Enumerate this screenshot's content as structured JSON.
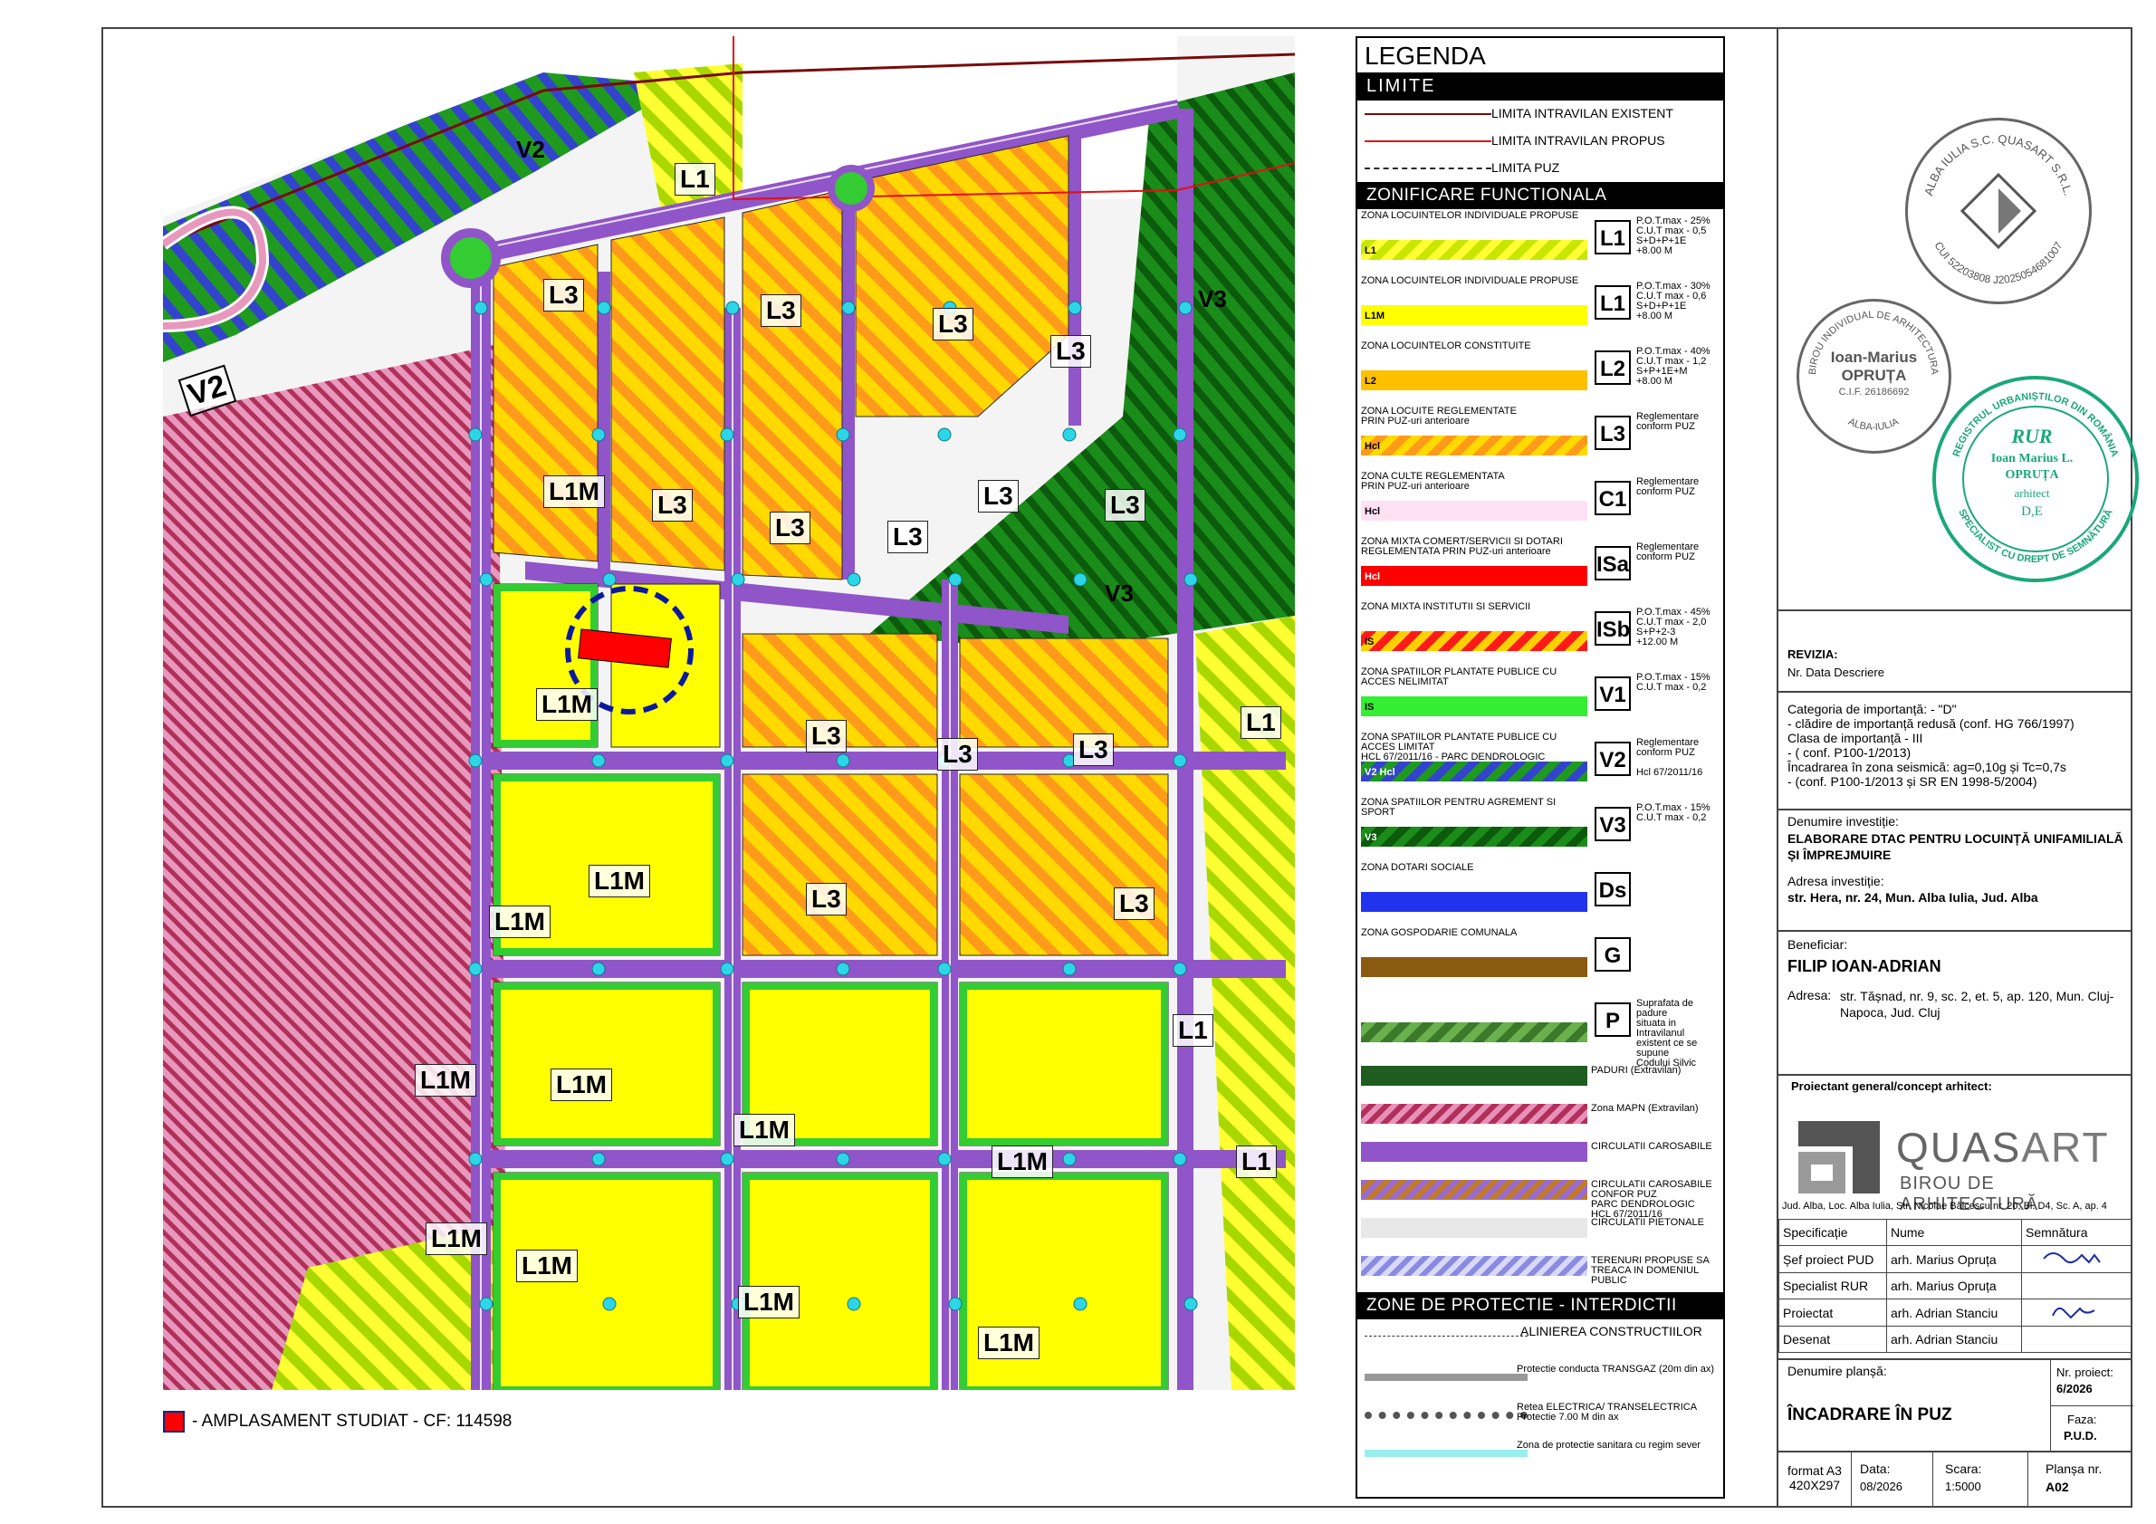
{
  "map": {
    "zone_labels": [
      "V2",
      "V2",
      "V3",
      "V3",
      "L1",
      "L1",
      "L1",
      "L1"
    ],
    "lot_labels": [
      "L3",
      "L3",
      "L3",
      "L3",
      "L3",
      "L3",
      "L3",
      "L3",
      "L3",
      "L3",
      "L3",
      "L3",
      "L3",
      "L3"
    ],
    "lot_l1m": [
      "L1M",
      "L1M",
      "L1M",
      "L1M",
      "L1M",
      "L1M",
      "L1M",
      "L1M",
      "L1M",
      "L1M",
      "L1M",
      "L1M"
    ],
    "footnote": "- AMPLASAMENT STUDIAT - CF: 114598"
  },
  "legend": {
    "title": "LEGENDA",
    "limite_head": "LIMITE",
    "limite": [
      {
        "label": "LIMITA INTRAVILAN EXISTENT",
        "color": "#7a0a0a"
      },
      {
        "label": "LIMITA INTRAVILAN PROPUS",
        "color": "#e01010"
      },
      {
        "label": "LIMITA PUZ",
        "color": "#2a2a2a"
      }
    ],
    "zonificare_head": "ZONIFICARE FUNCTIONALA",
    "zones": [
      {
        "text": "ZONA LOCUINTELOR INDIVIDUALE PROPUSE",
        "sub": "L1",
        "code": "L1",
        "desc": "P.O.T.max - 25%\nC.U.T max - 0,5\nS+D+P+1E\n+8.00 M",
        "color1": "#c8e600",
        "color2": "#ffff33"
      },
      {
        "text": "ZONA LOCUINTELOR INDIVIDUALE PROPUSE",
        "sub": "L1M",
        "code": "L1",
        "desc": "P.O.T.max - 30%\nC.U.T max - 0,6\nS+D+P+1E\n+8.00 M",
        "color1": "#ffff00",
        "color2": "#ffff00"
      },
      {
        "text": "ZONA LOCUINTELOR CONSTITUITE",
        "sub": "L2",
        "code": "L2",
        "desc": "P.O.T.max - 40%\nC.U.T max - 1,2\nS+P+1E+M\n+8.00 M",
        "color1": "#ffc000",
        "color2": "#ffc000"
      },
      {
        "text": "ZONA LOCUITE REGLEMENTATE\nPRIN PUZ-uri anterioare",
        "sub": "Hcl",
        "code": "L3",
        "desc": "Reglementare\nconform PUZ",
        "color1": "#ffd900",
        "color2": "#ff9a1a"
      },
      {
        "text": "ZONA CULTE REGLEMENTATA\nPRIN PUZ-uri anterioare",
        "sub": "Hcl",
        "code": "C1",
        "desc": "Reglementare\nconform PUZ",
        "color1": "#ffe0f4",
        "color2": "#ffe0f4"
      },
      {
        "text": "ZONA MIXTA COMERT/SERVICII SI DOTARI\nREGLEMENTATA PRIN PUZ-uri anterioare",
        "sub": "Hcl",
        "code": "ISa",
        "desc": "Reglementare\nconform PUZ",
        "color1": "#ff0000",
        "color2": "#ff0000"
      },
      {
        "text": "ZONA MIXTA INSTITUTII SI SERVICII",
        "sub": "IS",
        "code": "ISb",
        "desc": "P.O.T.max - 45%\nC.U.T max - 2,0\nS+P+2-3\n+12.00 M",
        "color1": "#ff1a1a",
        "color2": "#ffd000"
      },
      {
        "text": "ZONA SPATIILOR PLANTATE PUBLICE CU ACCES NELIMITAT",
        "sub": "IS",
        "code": "V1",
        "desc": "P.O.T.max - 15%\nC.U.T max - 0,2",
        "color1": "#33ee33",
        "color2": "#33ee33"
      },
      {
        "text": "ZONA SPATIILOR PLANTATE PUBLICE CU ACCES LIMITAT\nHCL 67/2011/16 - PARC DENDROLOGIC",
        "sub": "V2 Hcl",
        "code": "V2",
        "desc": "Reglementare\nconform PUZ\n\nHcl 67/2011/16",
        "color1": "#1f9a1f",
        "color2": "#3344cc"
      },
      {
        "text": "ZONA SPATIILOR PENTRU AGREMENT SI SPORT",
        "sub": "V3",
        "code": "V3",
        "desc": "P.O.T.max - 15%\nC.U.T max - 0,2",
        "color1": "#1a8c1a",
        "color2": "#0c5a0c"
      },
      {
        "text": "ZONA DOTARI SOCIALE",
        "sub": "",
        "code": "Ds",
        "desc": "",
        "color1": "#2233ee",
        "color2": "#2233ee"
      },
      {
        "text": "ZONA GOSPODARIE COMUNALA",
        "sub": "",
        "code": "G",
        "desc": "",
        "color1": "#8a5a10",
        "color2": "#8a5a10"
      },
      {
        "text": "",
        "sub": "",
        "code": "P",
        "desc": "Suprafata de padure\nsituata in Intravilanul\nexistent ce se supune\nCodului Silvic",
        "color1": "#6ab04c",
        "color2": "#3a7a2a"
      }
    ],
    "zones2": [
      {
        "text": "PADURI (Extravilan)",
        "color1": "#1f5c1f",
        "color2": "#1f5c1f"
      },
      {
        "text": "Zona MAPN (Extravilan)",
        "color1": "#b0305a",
        "color2": "#e890b8"
      },
      {
        "text": "CIRCULATII CAROSABILE",
        "color1": "#9055c8",
        "color2": "#9055c8"
      },
      {
        "text": "CIRCULATII CAROSABILE\nCONFOR PUZ\nPARC DENDROLOGIC\nHCL 67/2011/16",
        "color1": "#c07a2a",
        "color2": "#9a6ad0"
      },
      {
        "text": "CIRCULATII PIETONALE",
        "color1": "#e8e8e8",
        "color2": "#e8e8e8"
      },
      {
        "text": "TERENURI PROPUSE SA\nTREACA IN DOMENIUL PUBLIC",
        "color1": "#d8d8f8",
        "color2": "#8a8ae0"
      }
    ],
    "protectie_head": "ZONE DE PROTECTIE - INTERDICTII",
    "protectie": [
      "ALINIEREA CONSTRUCTIILOR",
      "Protectie conducta TRANSGAZ (20m din ax)",
      "Retea ELECTRICA/ TRANSELECTRICA\nProtectie 7.00 M din ax",
      "Zona de protectie sanitara cu regim sever"
    ]
  },
  "stamps": {
    "s1_top": "ALBA IULIA S.C. QUASART S.R.L.",
    "s1_bottom": "CUI 52203808 J2025054681007",
    "s2_top": "BIROU INDIVIDUAL DE ARHITECTURA",
    "s2_name1": "Ioan-Marius",
    "s2_name2": "OPRUȚA",
    "s2_cif": "C.I.F. 26186692",
    "s2_city": "ALBA-IULIA",
    "s3_top": "REGISTRUL URBANIȘTILOR DIN ROMÂNIA",
    "s3_bottom": "SPECIALIST CU DREPT DE SEMNĂTURĂ",
    "s3_rur": "RUR",
    "s3_name1": "Ioan Marius L.",
    "s3_name2": "OPRUȚA",
    "s3_role": "arhitect",
    "s3_grade": "D,E"
  },
  "titleblock": {
    "revizia": "REVIZIA:",
    "rev_cols": "Nr. Data Descriere",
    "categoria": "Categoria de importanță: - \"D\"\n- clădire de importanță redusă (conf. HG 766/1997)\n  Clasa de importanță - III\n- ( conf. P100-1/2013)\nÎncadrarea în zona seismică: ag=0,10g și Tc=0,7s\n- (conf. P100-1/2013 și SR EN 1998-5/2004)",
    "den_inv_label": "Denumire investiție:",
    "den_inv": "ELABORARE DTAC PENTRU LOCUINȚĂ UNIFAMILIALĂ ȘI ÎMPREJMUIRE",
    "adresa_label": "Adresa investiție:",
    "adresa": "str. Hera, nr. 24, Mun. Alba Iulia, Jud. Alba",
    "benef_label": "Beneficiar:",
    "benef": "FILIP IOAN-ADRIAN",
    "benef_adresa_label": "Adresa:",
    "benef_adresa": "str. Tășnad, nr. 9, sc. 2, et. 5, ap. 120, Mun. Cluj-Napoca, Jud. Cluj",
    "proiectant": "Proiectant general/concept arhitect:",
    "logo_name1": "QUAS",
    "logo_name2": "ART",
    "logo_sub": "BIROU DE ARHITECTURĂ",
    "logo_addr": "Jud. Alba, Loc. Alba Iulia, Str. Nicolae Bălcescu nr. 20, Bl. D4, Sc. A, ap. 4",
    "table_head": [
      "Specificație",
      "Nume",
      "Semnătura"
    ],
    "table_rows": [
      [
        "Șef proiect PUD",
        "arh. Marius Opruța"
      ],
      [
        "Specialist RUR",
        "arh. Marius Opruța"
      ],
      [
        "Proiectat",
        "arh. Adrian Stanciu"
      ],
      [
        "Desenat",
        "arh. Adrian Stanciu"
      ]
    ],
    "den_plansa_label": "Denumire planșă:",
    "den_plansa": "ÎNCADRARE ÎN PUZ",
    "nr_proiect_label": "Nr. proiect:",
    "nr_proiect": "6/2026",
    "faza_label": "Faza:",
    "faza": "P.U.D.",
    "format_label": "format A3",
    "format": "420X297",
    "data_label": "Data:",
    "data": "08/2026",
    "scara_label": "Scara:",
    "scara": "1:5000",
    "plansa_label": "Planșa nr.",
    "plansa": "A02"
  }
}
